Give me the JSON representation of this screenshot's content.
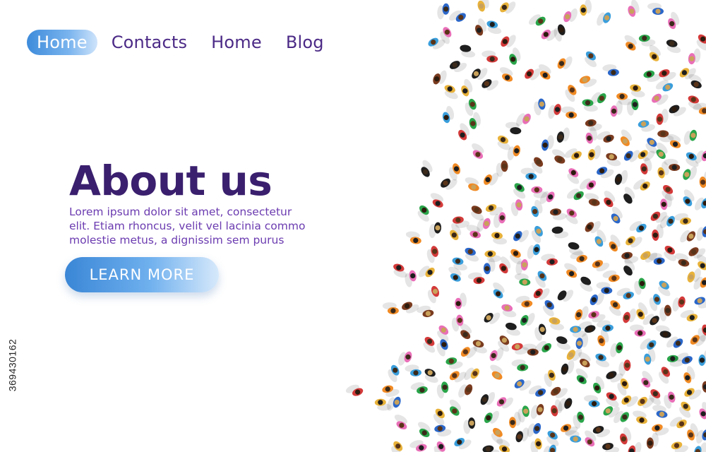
{
  "nav": {
    "items": [
      {
        "label": "Home",
        "active": true
      },
      {
        "label": "Contacts",
        "active": false
      },
      {
        "label": "Home",
        "active": false
      },
      {
        "label": "Blog",
        "active": false
      }
    ]
  },
  "hero": {
    "title": "About us",
    "body": "Lorem ipsum dolor sit amet, consectetur elit. Etiam rhoncus, velit vel lacinia commo molestie metus, a dignissim sem purus",
    "cta_label": "LEARN MORE"
  },
  "illustration": {
    "subject": "top-down crowd of people",
    "palette": [
      "#2b67c9",
      "#7a3b1f",
      "#e8b23a",
      "#1e1e1e",
      "#d43a3a",
      "#e96fb8",
      "#2aa54a",
      "#3a9edb",
      "#f08a24"
    ]
  },
  "stock_id": "369430162",
  "colors": {
    "accent_blue": "#3d8bdb",
    "heading": "#3a1f6e",
    "text": "#6b3bb0"
  }
}
